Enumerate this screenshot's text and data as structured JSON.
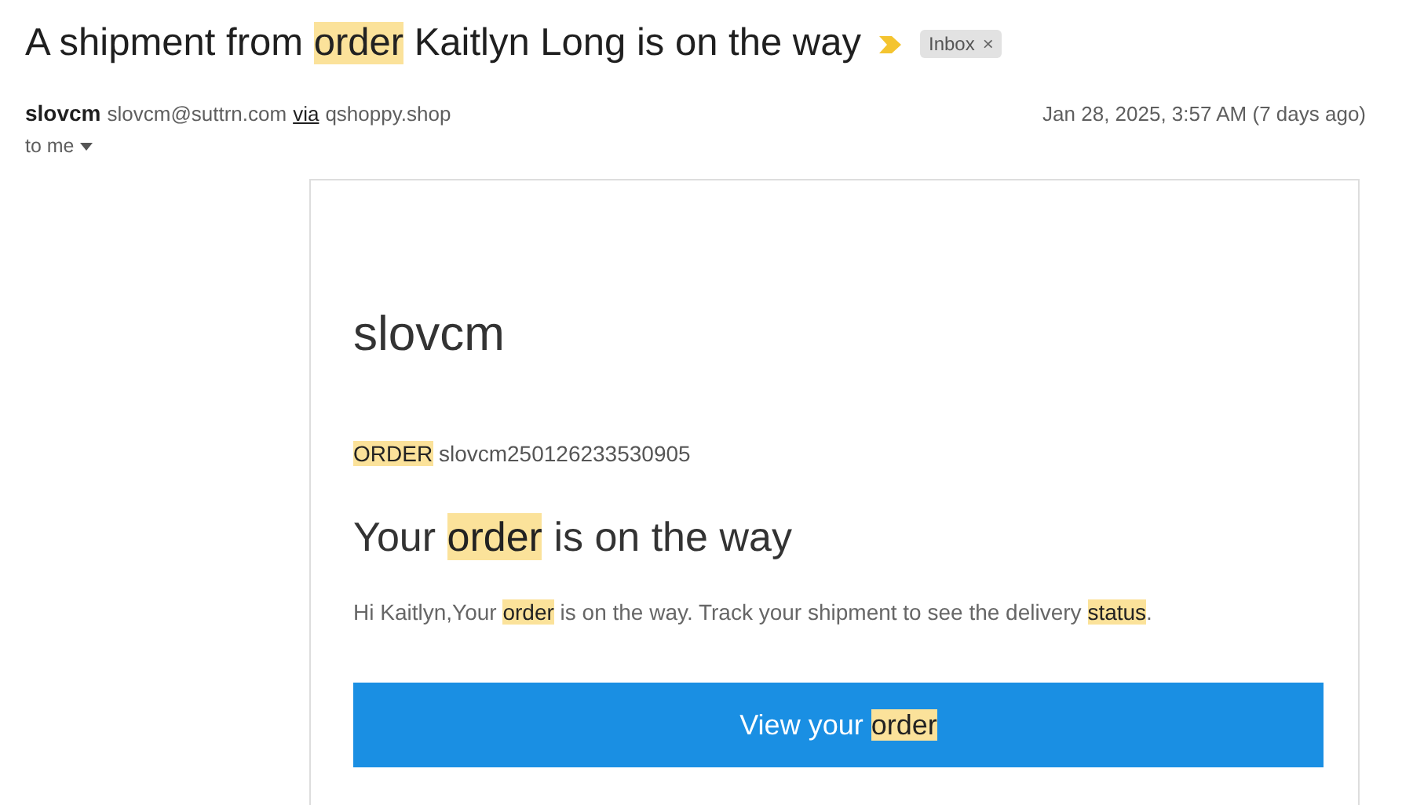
{
  "subject": [
    {
      "text": "A shipment from ",
      "highlighted": false
    },
    {
      "text": "order",
      "highlighted": true
    },
    {
      "text": " Kaitlyn Long is on the way",
      "highlighted": false
    }
  ],
  "important": true,
  "label": {
    "text": "Inbox",
    "remove": "×"
  },
  "sender": {
    "name": "slovcm",
    "email": "slovcm@suttrn.com",
    "via": "via",
    "domain": "qshoppy.shop",
    "date": "Jan 28, 2025, 3:57 AM (7 days ago)",
    "recipient": "to me"
  },
  "body": {
    "brand": "slovcm",
    "order_line": [
      {
        "text": "ORDER",
        "highlighted": true
      },
      {
        "text": " slovcm250126233530905",
        "highlighted": false
      }
    ],
    "heading": [
      {
        "text": "Your ",
        "highlighted": false
      },
      {
        "text": "order",
        "highlighted": true
      },
      {
        "text": " is on the way",
        "highlighted": false
      }
    ],
    "message": [
      {
        "text": "Hi Kaitlyn,Your ",
        "highlighted": false
      },
      {
        "text": "order",
        "highlighted": true
      },
      {
        "text": " is on the way. Track your shipment to see the delivery ",
        "highlighted": false
      },
      {
        "text": "status",
        "highlighted": true
      },
      {
        "text": ".",
        "highlighted": false
      }
    ],
    "button": [
      {
        "text": "View your ",
        "highlighted": false
      },
      {
        "text": "order",
        "highlighted": true
      }
    ]
  }
}
